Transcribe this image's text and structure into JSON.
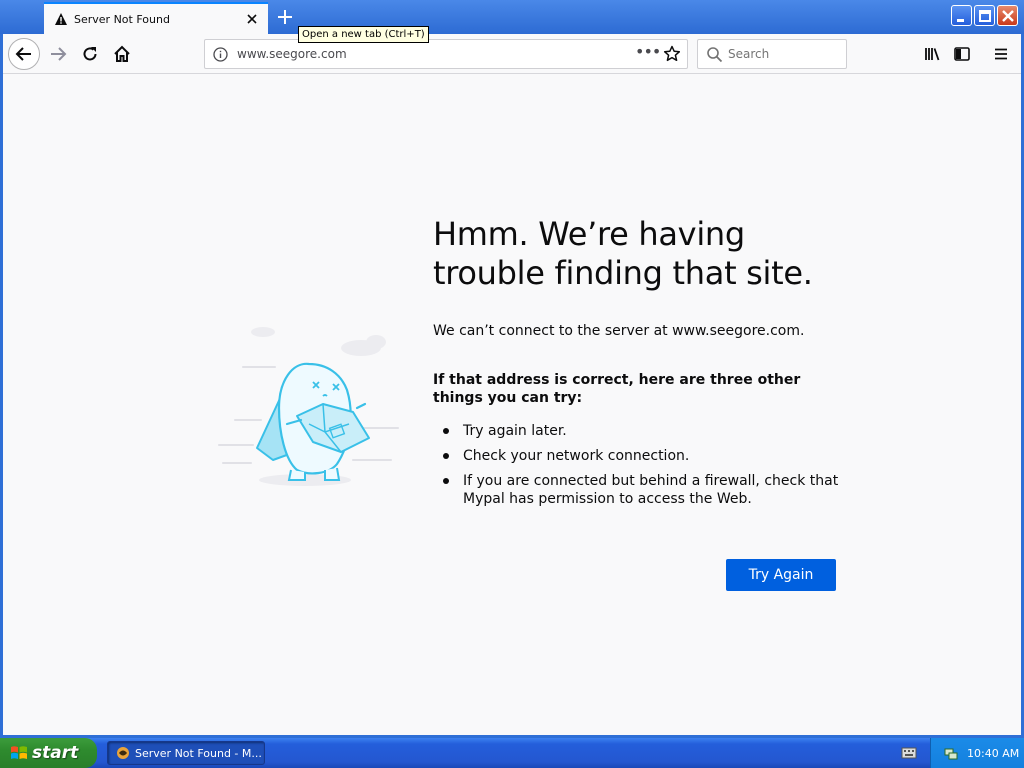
{
  "browser": {
    "tab_title": "Server Not Found",
    "tooltip": "Open a new tab (Ctrl+T)",
    "url": "www.seegore.com",
    "search_placeholder": "Search"
  },
  "error_page": {
    "title": "Hmm. We’re having trouble finding that site.",
    "description": "We can’t connect to the server at www.seegore.com.",
    "suggest_heading": "If that address is correct, here are three other things you can try:",
    "suggestions": [
      "Try again later.",
      "Check your network connection.",
      "If you are connected but behind a firewall, check that Mypal has permission to access the Web."
    ],
    "try_again_label": "Try Again"
  },
  "taskbar": {
    "start_label": "start",
    "task_label": "Server Not Found - M...",
    "clock": "10:40 AM"
  },
  "colors": {
    "accent": "#0060df",
    "page_bg": "#f9f9fa",
    "xp_blue": "#245edb",
    "xp_start_green": "#2e8b2e"
  }
}
